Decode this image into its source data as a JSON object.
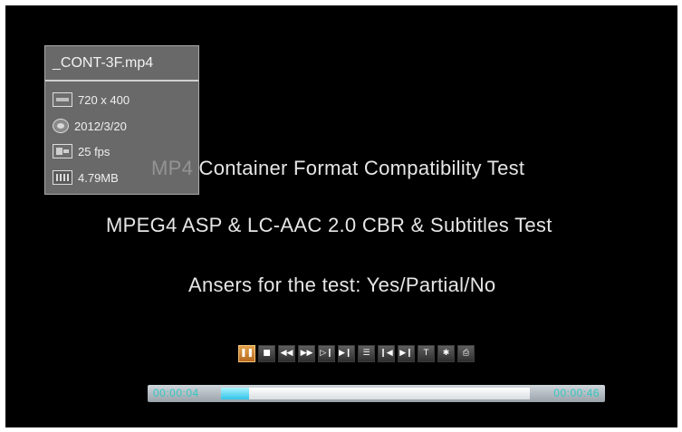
{
  "file_info": {
    "filename": "_CONT-3F.mp4",
    "resolution": "720 x 400",
    "date": "2012/3/20",
    "framerate": "25 fps",
    "size": "4.79MB",
    "icons": [
      "resolution-icon",
      "date-icon",
      "framerate-icon",
      "filesize-icon"
    ]
  },
  "video_text": {
    "line1": "MP4 Container Format Compatibility Test",
    "line2": "MPEG4 ASP & LC-AAC 2.0 CBR & Subtitles Test",
    "line3": "Ansers for the test: Yes/Partial/No"
  },
  "controls": {
    "buttons": [
      {
        "name": "pause-button",
        "glyph": "❚❚",
        "active": true
      },
      {
        "name": "stop-button",
        "glyph": "■"
      },
      {
        "name": "rewind-button",
        "glyph": "◀◀"
      },
      {
        "name": "fast-forward-button",
        "glyph": "▶▶"
      },
      {
        "name": "slow-forward-button",
        "glyph": "▷❙"
      },
      {
        "name": "step-forward-button",
        "glyph": "▶❙❙"
      },
      {
        "name": "subtitle-button",
        "glyph": "☰"
      },
      {
        "name": "previous-button",
        "glyph": "❙◀"
      },
      {
        "name": "next-button",
        "glyph": "▶❙"
      },
      {
        "name": "goto-time-button",
        "glyph": "T"
      },
      {
        "name": "settings-button",
        "glyph": "✱"
      },
      {
        "name": "info-button",
        "glyph": "⎙"
      }
    ]
  },
  "progress": {
    "elapsed": "00:00:04",
    "total": "00:00:46",
    "fraction": 0.09,
    "fill_color": "#31c4ea",
    "time_color": "#34c7c2"
  }
}
